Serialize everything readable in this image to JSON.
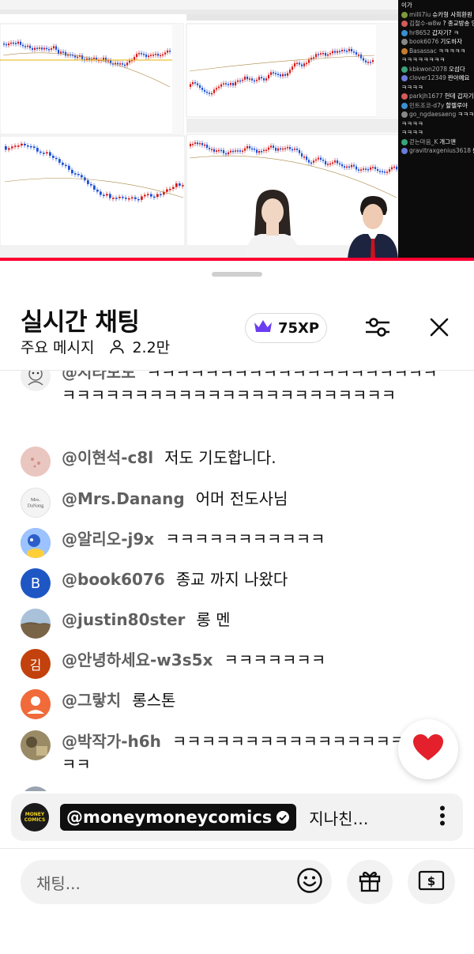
{
  "stream_chat_overlay": [
    {
      "name": "",
      "text": "이가"
    },
    {
      "name": "milli7iu",
      "text": "슈카형 사회환원 하죠?"
    },
    {
      "name": "김철수-w8w",
      "text": "? 종교방송 인가요????????"
    },
    {
      "name": "hr8652",
      "text": "갑자기? ㅋ"
    },
    {
      "name": "book6076",
      "text": "기도하자"
    },
    {
      "name": "Basassac",
      "text": "ㅋㅋㅋㅋㅋ"
    },
    {
      "name": "",
      "text": "ㅋㅋㅋㅋㅋㅋㅋㅋ"
    },
    {
      "name": "kbkwon2078",
      "text": "오섬다"
    },
    {
      "name": "clover12349",
      "text": "짠아예요"
    },
    {
      "name": "",
      "text": "ㅋㅋㅋㅋ"
    },
    {
      "name": "parkjh1677",
      "text": "헌데 갑자기"
    },
    {
      "name": "민트조코-d7y",
      "text": "할렐루야"
    },
    {
      "name": "go_ngdaesaeng",
      "text": "ㅋㅋㅋ"
    },
    {
      "name": "",
      "text": "ㅋㅋㅋㅋ"
    },
    {
      "name": "",
      "text": "ㅋㅋㅋㅋ"
    },
    {
      "name": "걷는마음_K",
      "text": "개그맨"
    },
    {
      "name": "gravitraxgenius3618",
      "text": "롱빤"
    }
  ],
  "stream_progress": 1.0,
  "header": {
    "title": "실시간 채팅",
    "mode": "주요 메시지",
    "viewers": "2.2만",
    "xp": "75XP"
  },
  "messages": [
    {
      "author": "@시라모도",
      "text": "ㅋㅋㅋㅋㅋㅋㅋㅋㅋㅋㅋㅋㅋㅋㅋㅋㅋㅋㅋㅋㅋㅋㅋㅋㅋㅋㅋㅋㅋㅋㅋㅋㅋㅋㅋㅋㅋㅋㅋㅋㅋㅋㅋ",
      "avatar_letter": "",
      "avatar_color": "#e9e9e9"
    },
    {
      "author": "@이현석-c8l",
      "text": "저도 기도합니다.",
      "avatar_letter": "",
      "avatar_color": "#e8b9b4"
    },
    {
      "author": "@Mrs.Danang",
      "text": "어머 전도사님",
      "avatar_letter": "",
      "avatar_color": "#f5f5f5"
    },
    {
      "author": "@알리오-j9x",
      "text": "ㅋㅋㅋㅋㅋㅋㅋㅋㅋㅋㅋ",
      "avatar_letter": "",
      "avatar_color": "#4a7fd8"
    },
    {
      "author": "@book6076",
      "text": "종교 까지 나왔다",
      "avatar_letter": "B",
      "avatar_color": "#1e57c4"
    },
    {
      "author": "@justin80ster",
      "text": "롱 멘",
      "avatar_letter": "",
      "avatar_color": "#8a7560"
    },
    {
      "author": "@안녕하세요-w3s5x",
      "text": "ㅋㅋㅋㅋㅋㅋㅋ",
      "avatar_letter": "김",
      "avatar_color": "#c2410c"
    },
    {
      "author": "@그랗치",
      "text": "롱스톤",
      "avatar_letter": "",
      "avatar_color": "#f06a3a"
    },
    {
      "author": "@박작가-h6h",
      "text": "ㅋㅋㅋㅋㅋㅋㅋㅋㅋㅋㅋㅋㅋㅋㅋㅋㅋㅋㅋㅋ",
      "avatar_letter": "",
      "avatar_color": "#8b7b55"
    }
  ],
  "pinned": {
    "logo_line1": "MONEY",
    "logo_line2": "COMICS",
    "author": "@moneymoneycomics",
    "text": "지나친…"
  },
  "input": {
    "placeholder": "채팅..."
  },
  "colors": {
    "accent_red": "#ff0033",
    "crown_purple": "#6a3df0",
    "heart_red": "#e3202b",
    "name_gray": "#606060"
  },
  "icons": [
    "crown-icon",
    "person-icon",
    "sliders-icon",
    "close-icon",
    "heart-icon",
    "verified-icon",
    "more-vert-icon",
    "emoji-icon",
    "gift-icon",
    "super-chat-icon"
  ]
}
